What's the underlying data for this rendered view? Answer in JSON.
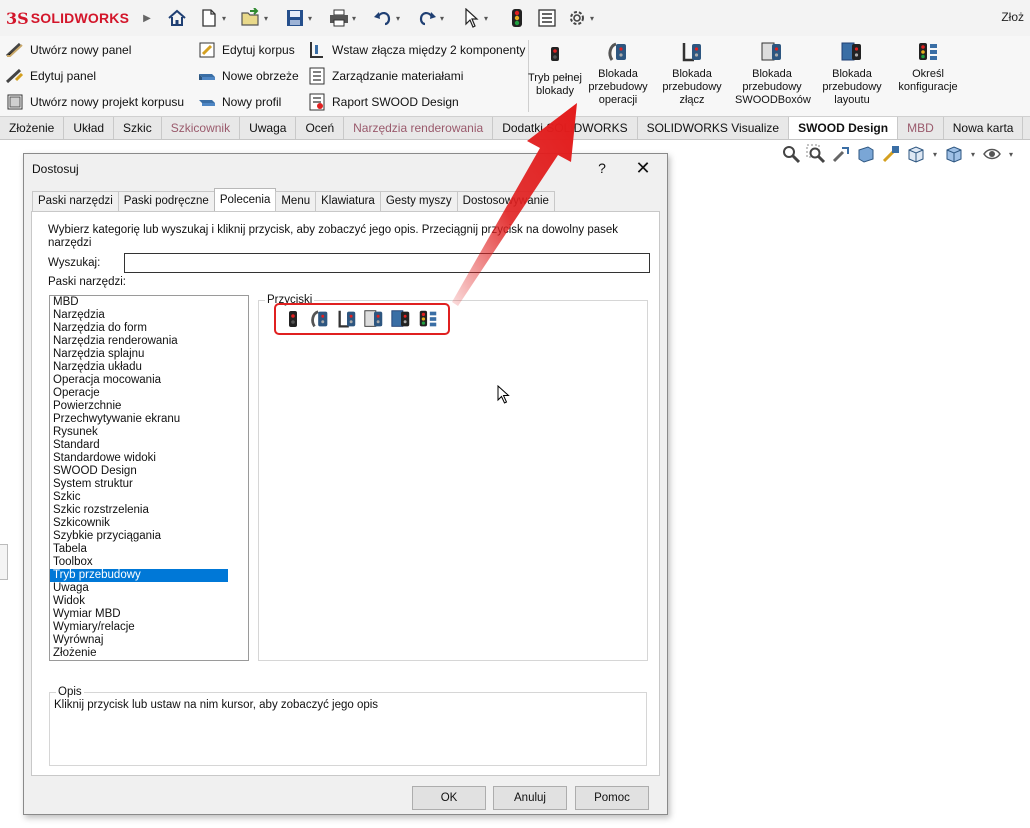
{
  "app": {
    "logo_ds": "3S",
    "logo_text": "SOLIDWORKS",
    "title_right": "Złoż"
  },
  "quick_access": [
    {
      "name": "home-icon",
      "dropdown": false
    },
    {
      "name": "new-document-icon",
      "dropdown": true
    },
    {
      "name": "open-icon",
      "dropdown": true
    },
    {
      "name": "save-icon",
      "dropdown": true
    },
    {
      "name": "print-icon",
      "dropdown": true
    },
    {
      "name": "undo-icon",
      "dropdown": true
    },
    {
      "name": "redo-icon",
      "dropdown": true
    },
    {
      "name": "select-icon",
      "dropdown": true
    },
    {
      "name": "traffic-light-icon",
      "dropdown": false
    },
    {
      "name": "file-properties-icon",
      "dropdown": true
    },
    {
      "name": "options-gear-icon",
      "dropdown": true
    }
  ],
  "commands": {
    "col1": [
      "Utwórz nowy panel",
      "Edytuj panel",
      "Utwórz nowy projekt korpusu"
    ],
    "col2": [
      "Edytuj korpus",
      "Nowe obrzeże",
      "Nowy profil"
    ],
    "col3": [
      "Wstaw złącza między 2 komponenty",
      "Zarządzanie materiałami",
      "Raport SWOOD Design"
    ],
    "big": [
      {
        "label": "Tryb pełnej blokady"
      },
      {
        "label": "Blokada przebudowy operacji"
      },
      {
        "label": "Blokada przebudowy złącz"
      },
      {
        "label": "Blokada przebudowy SWOODBoxów"
      },
      {
        "label": "Blokada przebudowy layoutu"
      },
      {
        "label": "Określ konfiguracje"
      }
    ]
  },
  "tabs": [
    {
      "label": "Złożenie",
      "state": "normal"
    },
    {
      "label": "Układ",
      "state": "normal"
    },
    {
      "label": "Szkic",
      "state": "normal"
    },
    {
      "label": "Szkicownik",
      "state": "dim"
    },
    {
      "label": "Uwaga",
      "state": "normal"
    },
    {
      "label": "Oceń",
      "state": "normal"
    },
    {
      "label": "Narzędzia renderowania",
      "state": "dim"
    },
    {
      "label": "Dodatki SOLIDWORKS",
      "state": "normal"
    },
    {
      "label": "SOLIDWORKS Visualize",
      "state": "normal"
    },
    {
      "label": "SWOOD Design",
      "state": "active"
    },
    {
      "label": "MBD",
      "state": "dim"
    },
    {
      "label": "Nowa karta",
      "state": "normal"
    }
  ],
  "dialog": {
    "title": "Dostosuj",
    "help": "?",
    "close": "✕",
    "tabs": [
      {
        "label": "Paski narzędzi",
        "active": false
      },
      {
        "label": "Paski podręczne",
        "active": false
      },
      {
        "label": "Polecenia",
        "active": true
      },
      {
        "label": "Menu",
        "active": false
      },
      {
        "label": "Klawiatura",
        "active": false
      },
      {
        "label": "Gesty myszy",
        "active": false
      },
      {
        "label": "Dostosowywanie",
        "active": false
      }
    ],
    "instructions": "Wybierz kategorię lub wyszukaj i kliknij przycisk, aby zobaczyć jego opis. Przeciągnij przycisk na dowolny pasek narzędzi",
    "search_label": "Wyszukaj:",
    "search_value": "",
    "categories_label": "Paski narzędzi:",
    "categories": [
      "MBD",
      "Narzędzia",
      "Narzędzia do form",
      "Narzędzia renderowania",
      "Narzędzia splajnu",
      "Narzędzia układu",
      "Operacja mocowania",
      "Operacje",
      "Powierzchnie",
      "Przechwytywanie ekranu",
      "Rysunek",
      "Standard",
      "Standardowe widoki",
      "SWOOD Design",
      "System struktur",
      "Szkic",
      "Szkic rozstrzelenia",
      "Szkicownik",
      "Szybkie przyciągania",
      "Tabela",
      "Toolbox",
      "Tryb przebudowy",
      "Uwaga",
      "Widok",
      "Wymiar MBD",
      "Wymiary/relacje",
      "Wyrównaj",
      "Złożenie"
    ],
    "selected_category": "Tryb przebudowy",
    "buttons_label": "Przyciski",
    "description_label": "Opis",
    "description_text": "Kliknij przycisk lub ustaw na nim kursor, aby zobaczyć jego opis",
    "ok": "OK",
    "cancel": "Anuluj",
    "help_button": "Pomoc"
  },
  "colors": {
    "brand_red": "#d3152a",
    "selection_blue": "#0078d7",
    "highlight_red": "#e02020"
  }
}
